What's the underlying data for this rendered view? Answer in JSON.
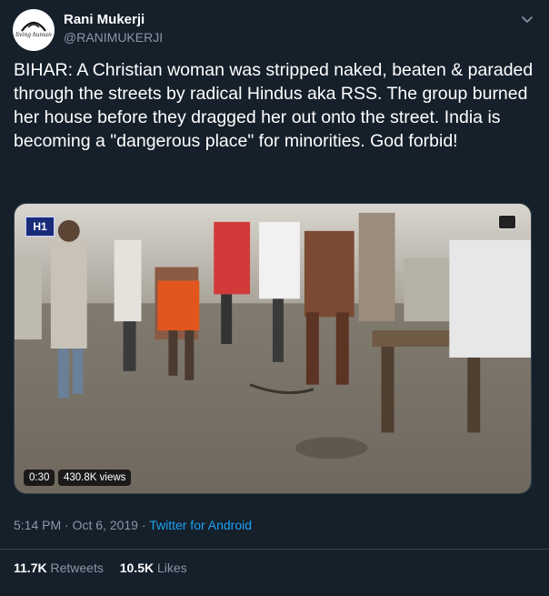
{
  "author": {
    "name": "Rani Mukerji",
    "handle": "@RANIMUKERJI",
    "avatar_text": "living human"
  },
  "tweet": {
    "text": "BIHAR: A Christian woman was stripped naked, beaten & paraded through the streets by radical Hindus aka RSS. The group burned her house before they dragged her out onto the street. India is becoming a \"dangerous place\" for minorities. God forbid!"
  },
  "media": {
    "channel_logo": "H1",
    "duration": "0:30",
    "views": "430.8K views"
  },
  "meta": {
    "time": "5:14 PM",
    "separator1": " · ",
    "date": "Oct 6, 2019",
    "separator2": " · ",
    "source": "Twitter for Android"
  },
  "stats": {
    "retweets_count": "11.7K",
    "retweets_label": "Retweets",
    "likes_count": "10.5K",
    "likes_label": "Likes"
  },
  "colors": {
    "background": "#15202b",
    "secondary_text": "#8899a6",
    "link": "#1da1f2",
    "border": "#38444d"
  },
  "icons": {
    "menu": "chevron-down-icon"
  }
}
